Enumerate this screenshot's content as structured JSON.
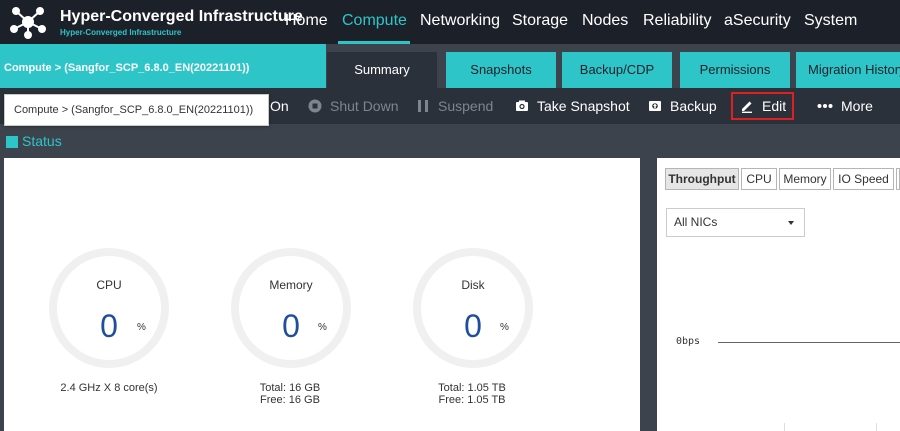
{
  "header": {
    "title": "Hyper-Converged Infrastructure",
    "subtitle": "Hyper-Converged Infrastructure",
    "nav": [
      "Home",
      "Compute",
      "Networking",
      "Storage",
      "Nodes",
      "Reliability",
      "aSecurity",
      "System"
    ],
    "active_nav": "Compute"
  },
  "breadcrumb": "Compute > (Sangfor_SCP_6.8.0_EN(20221101))",
  "tooltip": "Compute > (Sangfor_SCP_6.8.0_EN(20221101))",
  "tabs": [
    "Summary",
    "Snapshots",
    "Backup/CDP",
    "Permissions",
    "Migration History"
  ],
  "active_tab": "Summary",
  "toolbar": {
    "power_on_fragment": "On",
    "shut_down": "Shut Down",
    "suspend": "Suspend",
    "take_snapshot": "Take Snapshot",
    "backup": "Backup",
    "edit": "Edit",
    "more": "More"
  },
  "status_label": "Status",
  "gauges": [
    {
      "title": "CPU",
      "value": "0",
      "unit": "%",
      "info1": "2.4 GHz X 8 core(s)",
      "info2": ""
    },
    {
      "title": "Memory",
      "value": "0",
      "unit": "%",
      "info1": "Total: 16 GB",
      "info2": "Free: 16 GB"
    },
    {
      "title": "Disk",
      "value": "0",
      "unit": "%",
      "info1": "Total: 1.05 TB",
      "info2": "Free: 1.05 TB"
    }
  ],
  "metric_tabs": [
    "Throughput",
    "CPU",
    "Memory",
    "IO Speed"
  ],
  "active_metric_tab": "Throughput",
  "nic_select": "All NICs",
  "chart_data": {
    "type": "line",
    "y_tick_labels": [
      "0bps"
    ],
    "series": []
  },
  "colors": {
    "accent": "#2ec5c9",
    "topbar": "#1c2129",
    "highlight": "#e02020"
  }
}
